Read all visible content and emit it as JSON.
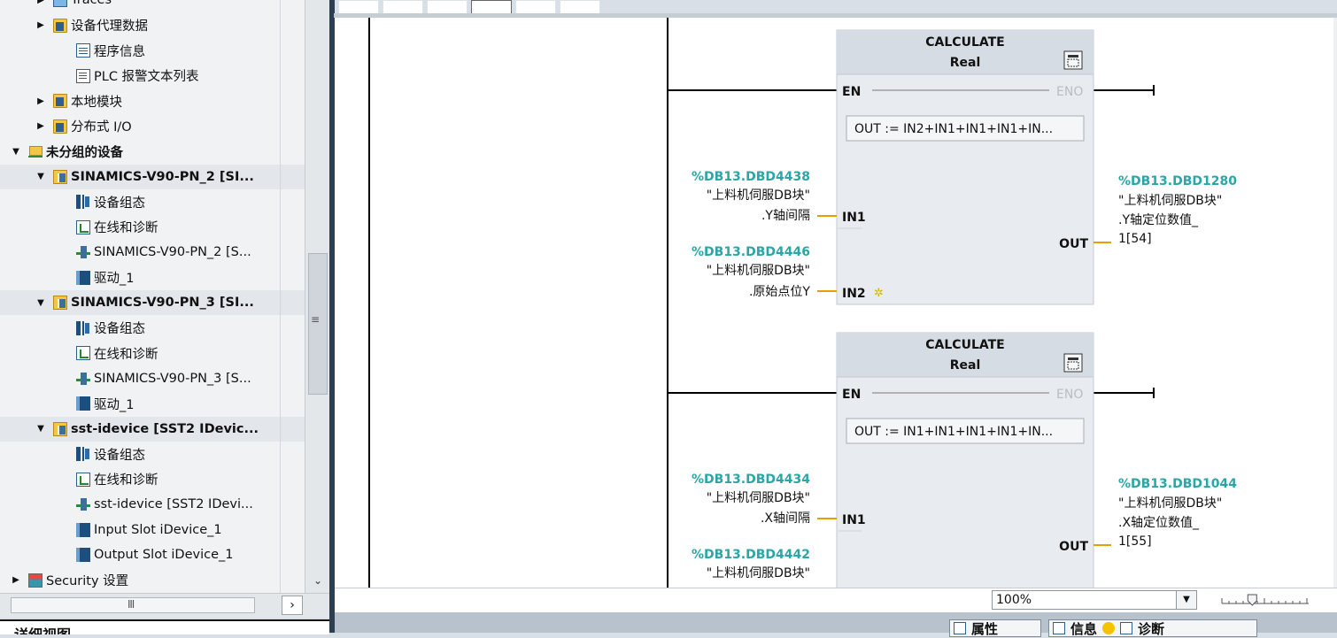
{
  "tree": {
    "items": [
      {
        "label": "Traces",
        "icon": "trace-icon",
        "toggle": "collapsed"
      },
      {
        "label": "设备代理数据",
        "icon": "folder-icon",
        "toggle": "collapsed"
      },
      {
        "label": "程序信息",
        "icon": "program-info-icon",
        "toggle": "none"
      },
      {
        "label": "PLC 报警文本列表",
        "icon": "text-list-icon",
        "toggle": "none"
      },
      {
        "label": "本地模块",
        "icon": "folder-icon",
        "toggle": "collapsed"
      },
      {
        "label": "分布式 I/O",
        "icon": "folder-icon",
        "toggle": "collapsed"
      },
      {
        "label": "未分组的设备",
        "icon": "device-group-icon",
        "toggle": "expanded"
      },
      {
        "label": "SINAMICS-V90-PN_2 [SI...",
        "icon": "device-icon",
        "toggle": "expanded"
      },
      {
        "label": "设备组态",
        "icon": "device-config-icon",
        "toggle": "none"
      },
      {
        "label": "在线和诊断",
        "icon": "online-diagnostics-icon",
        "toggle": "none"
      },
      {
        "label": "SINAMICS-V90-PN_2 [S...",
        "icon": "network-device-icon",
        "toggle": "none"
      },
      {
        "label": "驱动_1",
        "icon": "drive-icon",
        "toggle": "none"
      },
      {
        "label": "SINAMICS-V90-PN_3 [SI...",
        "icon": "device-icon",
        "toggle": "expanded"
      },
      {
        "label": "设备组态",
        "icon": "device-config-icon",
        "toggle": "none"
      },
      {
        "label": "在线和诊断",
        "icon": "online-diagnostics-icon",
        "toggle": "none"
      },
      {
        "label": "SINAMICS-V90-PN_3 [S...",
        "icon": "network-device-icon",
        "toggle": "none"
      },
      {
        "label": "驱动_1",
        "icon": "drive-icon",
        "toggle": "none"
      },
      {
        "label": "sst-idevice [SST2 IDevic...",
        "icon": "device-icon",
        "toggle": "expanded"
      },
      {
        "label": "设备组态",
        "icon": "device-config-icon",
        "toggle": "none"
      },
      {
        "label": "在线和诊断",
        "icon": "online-diagnostics-icon",
        "toggle": "none"
      },
      {
        "label": "sst-idevice [SST2 IDevi...",
        "icon": "network-device-icon",
        "toggle": "none"
      },
      {
        "label": "Input Slot iDevice_1",
        "icon": "drive-icon",
        "toggle": "none"
      },
      {
        "label": "Output Slot iDevice_1",
        "icon": "drive-icon",
        "toggle": "none"
      },
      {
        "label": "Security 设置",
        "icon": "security-settings-icon",
        "toggle": "collapsed"
      }
    ]
  },
  "detail_view": {
    "title": "详细视图"
  },
  "editor": {
    "blocks": [
      {
        "title": "CALCULATE",
        "type": "Real",
        "en": "EN",
        "eno": "ENO",
        "formula": "OUT :=  IN2+IN1+IN1+IN1+IN...",
        "in1_label": "IN1",
        "in2_label": "IN2",
        "out_label": "OUT",
        "in1": {
          "address": "%DB13.DBD4438",
          "db": "\"上料机伺服DB块\"",
          "member": ".Y轴间隔"
        },
        "in2": {
          "address": "%DB13.DBD4446",
          "db": "\"上料机伺服DB块\"",
          "member": ".原始点位Y"
        },
        "out": {
          "address": "%DB13.DBD1280",
          "db": "\"上料机伺服DB块\"",
          "member": ".Y轴定位数值_",
          "index": "1[54]"
        }
      },
      {
        "title": "CALCULATE",
        "type": "Real",
        "en": "EN",
        "eno": "ENO",
        "formula": "OUT :=  IN1+IN1+IN1+IN1+IN...",
        "in1_label": "IN1",
        "out_label": "OUT",
        "in1": {
          "address": "%DB13.DBD4434",
          "db": "\"上料机伺服DB块\"",
          "member": ".X轴间隔"
        },
        "in2": {
          "address": "%DB13.DBD4442",
          "db": "\"上料机伺服DB块\""
        },
        "out": {
          "address": "%DB13.DBD1044",
          "db": "\"上料机伺服DB块\"",
          "member": ".X轴定位数值_",
          "index": "1[55]"
        }
      }
    ]
  },
  "zoom": {
    "value": "100%",
    "level_fraction": 0.35
  },
  "bottom_tabs": [
    {
      "label": "属性",
      "icon": "properties-icon"
    },
    {
      "label": "信息",
      "icon": "info-icon"
    },
    {
      "label": "诊断",
      "icon": "diagnostics-icon"
    }
  ],
  "colors": {
    "address": "#2aa6a6",
    "block_fill": "#e8ebef",
    "block_header": "#d6dce3",
    "rung": "#000000"
  }
}
